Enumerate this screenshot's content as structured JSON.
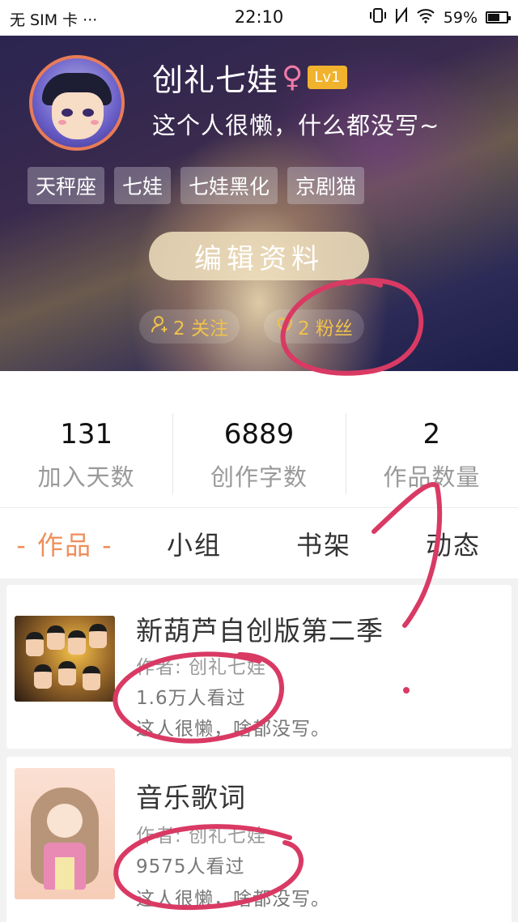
{
  "status_bar": {
    "carrier": "无 SIM 卡 ···",
    "time": "22:10",
    "battery": "59%"
  },
  "profile": {
    "username": "创礼七娃",
    "gender_symbol": "♀",
    "level": "Lv1",
    "bio": "这个人很懒，什么都没写~",
    "tags": [
      "天秤座",
      "七娃",
      "七娃黑化",
      "京剧猫"
    ],
    "edit_button": "编辑资料",
    "following": "2 关注",
    "followers": "2 粉丝"
  },
  "stats": [
    {
      "value": "131",
      "label": "加入天数"
    },
    {
      "value": "6889",
      "label": "创作字数"
    },
    {
      "value": "2",
      "label": "作品数量"
    }
  ],
  "tabs": [
    "- 作品 -",
    "小组",
    "书架",
    "动态"
  ],
  "works": [
    {
      "title": "新葫芦自创版第二季",
      "author": "作者: 创礼七娃",
      "views": "1.6万人看过",
      "desc": "这人很懒，啥都没写。"
    },
    {
      "title": "音乐歌词",
      "author": "作者: 创礼七娃",
      "views": "9575人看过",
      "desc": "这人很懒，啥都没写。"
    }
  ],
  "colors": {
    "accent": "#ef8e5b",
    "level_badge": "#f1b22e",
    "pill_text": "#f0c24a",
    "annotation": "#d93a64"
  }
}
